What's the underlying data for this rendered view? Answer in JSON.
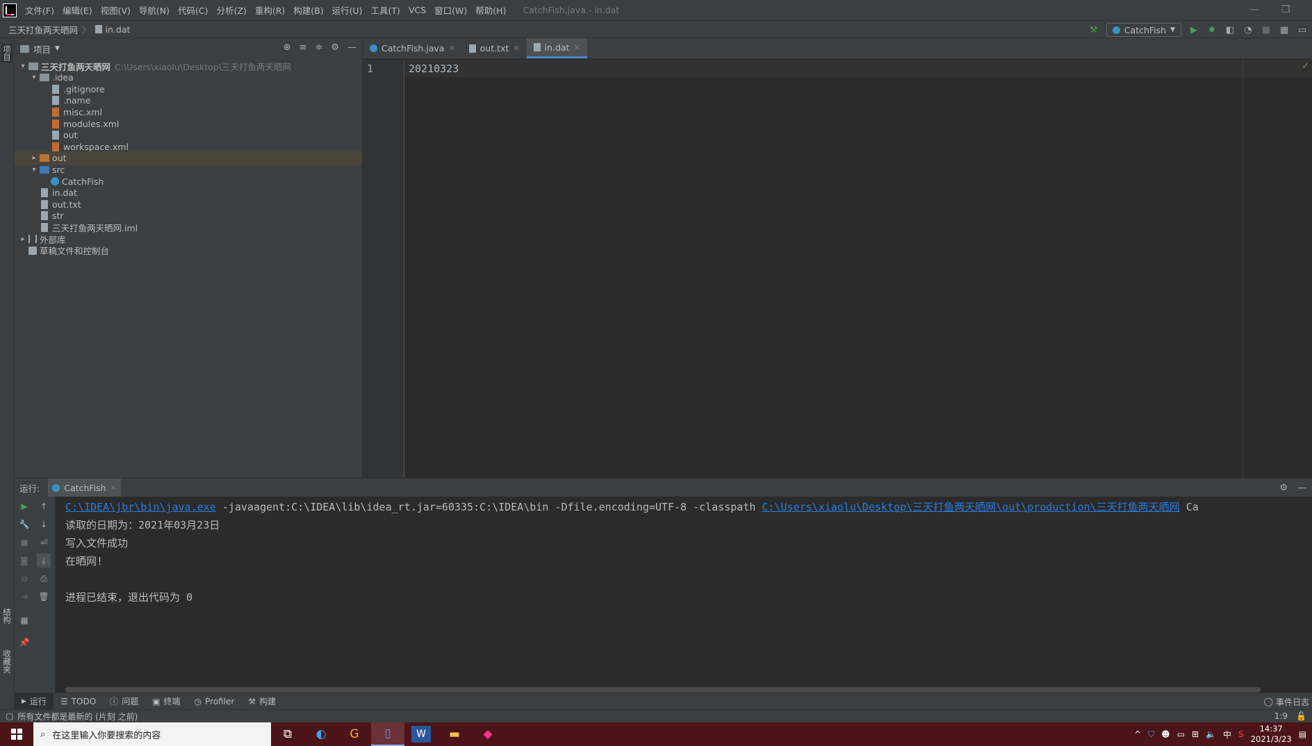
{
  "menu": {
    "items": [
      "文件(F)",
      "编辑(E)",
      "视图(V)",
      "导航(N)",
      "代码(C)",
      "分析(Z)",
      "重构(R)",
      "构建(B)",
      "运行(U)",
      "工具(T)",
      "VCS",
      "窗口(W)",
      "帮助(H)"
    ],
    "window_title": "CatchFish.java - in.dat"
  },
  "navbar": {
    "crumbs": [
      "三天打鱼两天晒网",
      "in.dat"
    ],
    "run_config": "CatchFish"
  },
  "left_stripe": {
    "project_label": "项目",
    "structure_label": "结构",
    "favorites_label": "收藏夹"
  },
  "project": {
    "title": "项目",
    "tree": [
      {
        "label": "三天打鱼两天晒网",
        "hint": "C:\\Users\\xiaolu\\Desktop\\三天打鱼两天晒网",
        "icon": "module-folder-icon",
        "depth": 0,
        "arrow": "▾"
      },
      {
        "label": ".idea",
        "icon": "folder-icon",
        "depth": 1,
        "arrow": "▾"
      },
      {
        "label": ".gitignore",
        "icon": "file-icon",
        "depth": 2,
        "arrow": ""
      },
      {
        "label": ".name",
        "icon": "file-icon",
        "depth": 2,
        "arrow": ""
      },
      {
        "label": "misc.xml",
        "icon": "xml-file-icon",
        "depth": 2,
        "arrow": ""
      },
      {
        "label": "modules.xml",
        "icon": "xml-file-icon",
        "depth": 2,
        "arrow": ""
      },
      {
        "label": "out",
        "icon": "file-icon",
        "depth": 2,
        "arrow": ""
      },
      {
        "label": "workspace.xml",
        "icon": "xml-file-icon",
        "depth": 2,
        "arrow": ""
      },
      {
        "label": "out",
        "icon": "excluded-folder-icon",
        "depth": 1,
        "arrow": "▸",
        "selected": true
      },
      {
        "label": "src",
        "icon": "source-folder-icon",
        "depth": 1,
        "arrow": "▾"
      },
      {
        "label": "CatchFish",
        "icon": "java-class-icon",
        "depth": 2,
        "arrow": ""
      },
      {
        "label": "in.dat",
        "icon": "file-icon",
        "depth": 1,
        "arrow": ""
      },
      {
        "label": "out.txt",
        "icon": "file-icon",
        "depth": 1,
        "arrow": ""
      },
      {
        "label": "str",
        "icon": "file-icon",
        "depth": 1,
        "arrow": ""
      },
      {
        "label": "三天打鱼两天晒网.iml",
        "icon": "file-icon",
        "depth": 1,
        "arrow": ""
      },
      {
        "label": "外部库",
        "icon": "library-icon",
        "depth": 0,
        "arrow": "▸"
      },
      {
        "label": "草稿文件和控制台",
        "icon": "scratch-icon",
        "depth": 0,
        "arrow": ""
      }
    ]
  },
  "editor": {
    "tabs": [
      {
        "label": "CatchFish.java",
        "icon": "java-class-icon",
        "active": false
      },
      {
        "label": "out.txt",
        "icon": "file-icon",
        "active": false
      },
      {
        "label": "in.dat",
        "icon": "file-icon",
        "active": true
      }
    ],
    "line_number": "1",
    "content": "20210323"
  },
  "run": {
    "label": "运行:",
    "tab": "CatchFish",
    "console": {
      "cmd_exe": "C:\\IDEA\\jbr\\bin\\java.exe",
      "cmd_args": " -javaagent:C:\\IDEA\\lib\\idea_rt.jar=60335:C:\\IDEA\\bin -Dfile.encoding=UTF-8 -classpath ",
      "cmd_classpath": "C:\\Users\\xiaolu\\Desktop\\三天打鱼两天晒网\\out\\production\\三天打鱼两天晒网",
      "cmd_tail": " Ca",
      "line2": "读取的日期为：2021年03月23日",
      "line3": "写入文件成功",
      "line4": "在晒网!",
      "line5": "进程已结束，退出代码为 0"
    }
  },
  "bottom_tools": {
    "run": "运行",
    "todo": "TODO",
    "problems": "问题",
    "terminal": "终端",
    "profiler": "Profiler",
    "build": "构建",
    "event_log": "事件日志"
  },
  "status": {
    "message": "所有文件都是最新的 (片刻 之前)",
    "position": "1:9"
  },
  "taskbar": {
    "search_placeholder": "在这里输入你要搜索的内容",
    "ime": "中",
    "time": "14:37",
    "date": "2021/3/23"
  },
  "colors": {
    "accent": "#4a88c7",
    "link": "#287bde",
    "run_green": "#499c54",
    "taskbar": "#4a1418"
  }
}
